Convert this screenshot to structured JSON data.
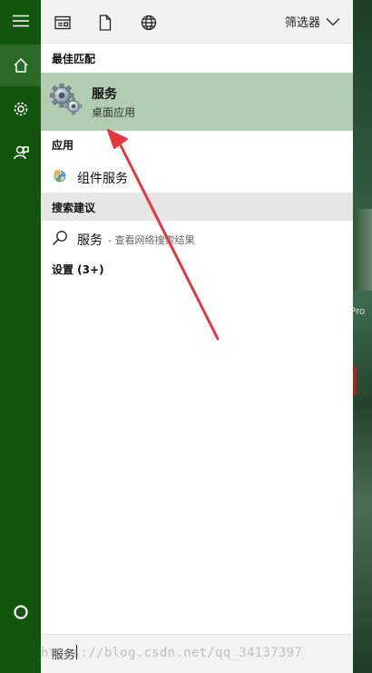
{
  "rail": {
    "items": [
      {
        "name": "hamburger-icon"
      },
      {
        "name": "home-icon",
        "active": true
      },
      {
        "name": "gear-icon"
      },
      {
        "name": "feedback-icon"
      }
    ],
    "cortana": {
      "name": "cortana-circle-icon"
    }
  },
  "topbar": {
    "icons": [
      "document-view-icon",
      "document-icon",
      "globe-icon"
    ],
    "filter_label": "筛选器"
  },
  "best_match": {
    "heading": "最佳匹配",
    "title": "服务",
    "subtitle": "桌面应用",
    "icon": "gears-icon"
  },
  "apps": {
    "heading": "应用",
    "items": [
      {
        "label": "组件服务",
        "icon": "component-services-icon"
      }
    ]
  },
  "suggestions": {
    "heading": "搜索建议",
    "items": [
      {
        "term": "服务",
        "desc": "- 查看网络搜索结果"
      }
    ]
  },
  "settings": {
    "heading": "设置 (3+)"
  },
  "search": {
    "value": "服务",
    "watermark": "https://blog.csdn.net/qq_34137397"
  },
  "desktop": {
    "edge_text": "Pro"
  },
  "colors": {
    "rail_bg": "#14550d",
    "highlight": "#b2ccb1",
    "arrow": "#e8373c"
  }
}
